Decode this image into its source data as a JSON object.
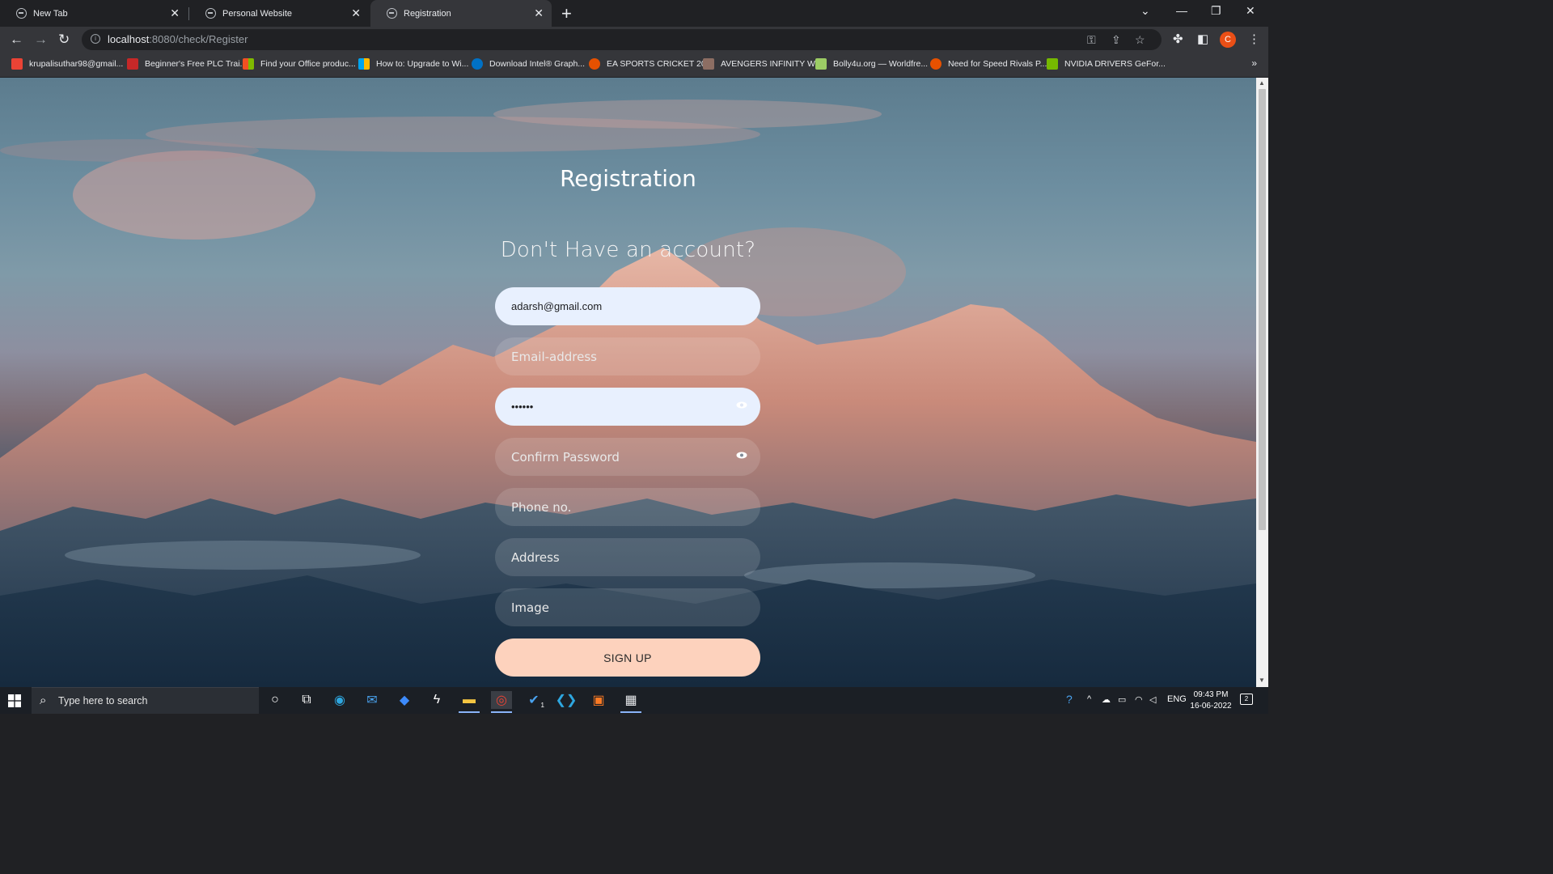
{
  "browser": {
    "tabs": [
      {
        "title": "New Tab",
        "active": false
      },
      {
        "title": "Personal Website",
        "active": false
      },
      {
        "title": "Registration",
        "active": true
      }
    ],
    "new_tab_label": "+",
    "close_glyph": "✕",
    "url_host": "localhost",
    "url_rest": ":8080/check/Register",
    "profile_initial": "C",
    "bookmarks_more": "»",
    "bookmarks": [
      {
        "title": "krupalisuthar98@gmail...",
        "icon": "gmail-icon",
        "color": "#ea4335"
      },
      {
        "title": "Beginner's Free PLC Trai...",
        "icon": "plc-icon",
        "color": "#c62828"
      },
      {
        "title": "Find your Office produc...",
        "icon": "microsoft-icon",
        "color": "#f25022"
      },
      {
        "title": "How to: Upgrade to Wi...",
        "icon": "microsoft-icon",
        "color": "#7fba00"
      },
      {
        "title": "Download Intel® Graph...",
        "icon": "intel-icon",
        "color": "#0071c5"
      },
      {
        "title": "EA SPORTS CRICKET 20...",
        "icon": "game-icon",
        "color": "#e65100"
      },
      {
        "title": "AVENGERS INFINITY W...",
        "icon": "hd-icon",
        "color": "#8d6e63"
      },
      {
        "title": "Bolly4u.org — Worldfre...",
        "icon": "w-icon",
        "color": "#9ccc65"
      },
      {
        "title": "Need for Speed Rivals P...",
        "icon": "game-icon",
        "color": "#e65100"
      },
      {
        "title": "NVIDIA DRIVERS GeFor...",
        "icon": "nvidia-icon",
        "color": "#76b900"
      }
    ]
  },
  "page": {
    "title": "Registration",
    "subtitle": "Don't Have an account?",
    "fields": {
      "username_value": "adarsh@gmail.com",
      "email_placeholder": "Email-address",
      "password_value": "••••••",
      "confirm_placeholder": "Confirm Password",
      "phone_placeholder": "Phone no.",
      "address_placeholder": "Address",
      "image_placeholder": "Image"
    },
    "signup_label": "SIGN UP",
    "colors": {
      "signup_bg": "#fdd2bd",
      "filled_field_bg": "#e8f0fe"
    }
  },
  "taskbar": {
    "search_placeholder": "Type here to search",
    "language": "ENG",
    "time": "09:43 PM",
    "date": "16-06-2022",
    "notification_count": "2",
    "todo_badge": "1"
  }
}
